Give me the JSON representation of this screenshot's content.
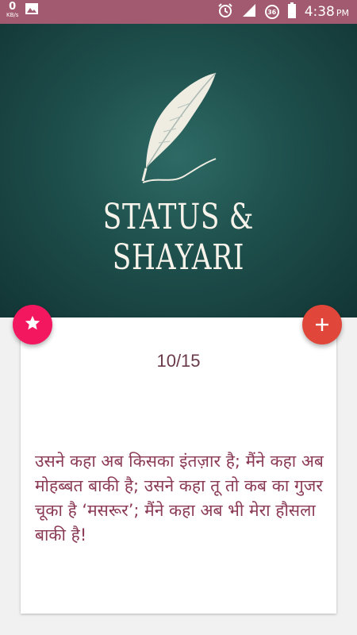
{
  "statusbar": {
    "net_speed": "0",
    "net_unit": "KB/s",
    "network_badge": "36",
    "time": "4:38",
    "ampm": "PM",
    "icons": [
      "image-icon",
      "alarm-icon",
      "signal-icon",
      "battery-icon"
    ]
  },
  "banner": {
    "title": "STATUS & SHAYARI",
    "icon": "feather-pen-icon"
  },
  "card": {
    "counter": "10/15",
    "quote": "उसने कहा अब किसका इंतज़ार है; मैंने कहा अब मोहब्बत बाकी है; उसने कहा तू तो कब का गुजर चूका है ‘मसरूर’; मैंने कहा अब भी मेरा हौसला बाकी है!"
  },
  "actions": {
    "favorite_icon": "star-icon",
    "add_icon": "plus-icon"
  },
  "colors": {
    "statusbar": "#a25a70",
    "banner": "#1e4f4c",
    "favorite_fab": "#f2175f",
    "add_fab": "#e0463a",
    "quote_text": "#8b3a56"
  }
}
